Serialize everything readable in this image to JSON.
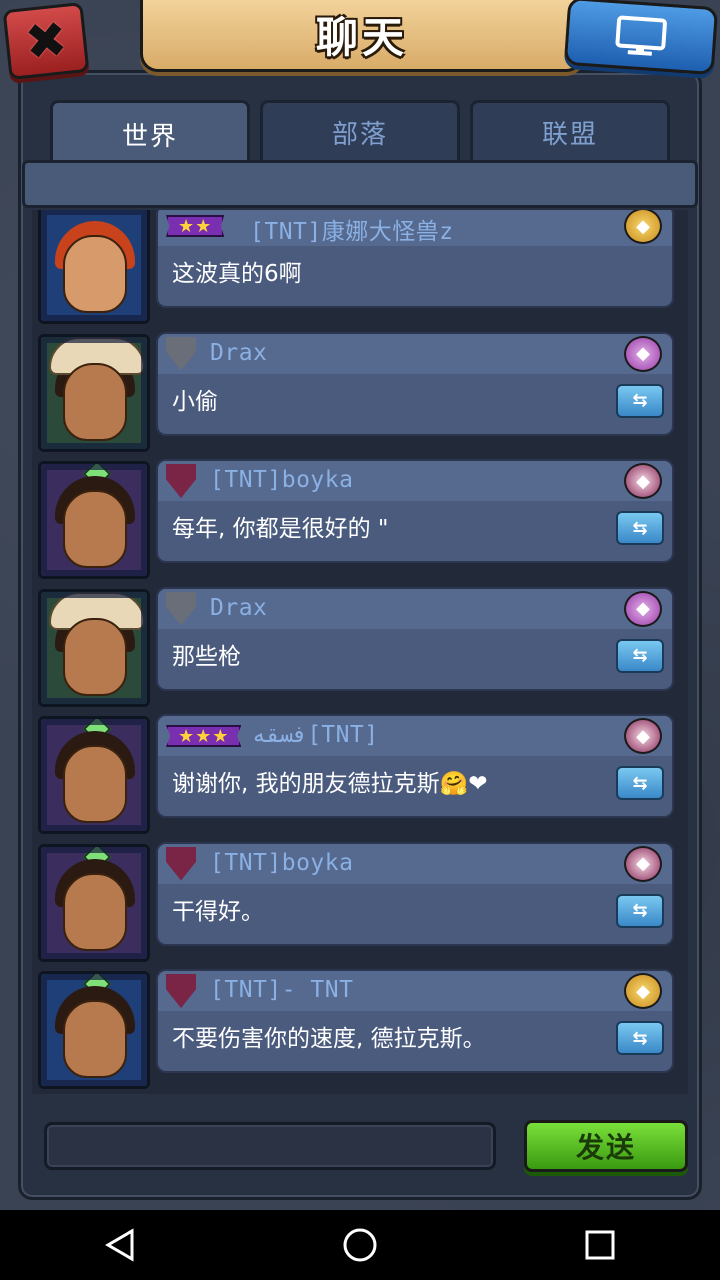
{
  "header": {
    "title": "聊天"
  },
  "tabs": [
    {
      "label": "世界"
    },
    {
      "label": "部落"
    },
    {
      "label": "联盟"
    }
  ],
  "messages": [
    {
      "rank": "★★",
      "name": "[TNT]康娜大怪兽z",
      "text": "这波真的6啊",
      "badge": "ribbon",
      "guild": "gold",
      "translate": false,
      "avatar": "blue-red"
    },
    {
      "rank": "",
      "name": "Drax",
      "text": "小偷",
      "badge": "gray",
      "guild": "purple",
      "translate": true,
      "avatar": "hood"
    },
    {
      "rank": "",
      "name": "[TNT]boyka",
      "text": "每年, 你都是很好的 \"",
      "badge": "maroon",
      "guild": "maroon",
      "translate": true,
      "avatar": "purple"
    },
    {
      "rank": "",
      "name": "Drax",
      "text": "那些枪",
      "badge": "gray",
      "guild": "purple",
      "translate": true,
      "avatar": "hood"
    },
    {
      "rank": "★★★",
      "name": "فسقه[TNT]",
      "text": "谢谢你, 我的朋友德拉克斯🤗❤",
      "badge": "ribbon",
      "guild": "maroon",
      "translate": true,
      "avatar": "purple"
    },
    {
      "rank": "",
      "name": "[TNT]boyka",
      "text": "干得好。",
      "badge": "maroon",
      "guild": "maroon",
      "translate": true,
      "avatar": "purple"
    },
    {
      "rank": "",
      "name": "[TNT]- TNT",
      "text": "不要伤害你的速度, 德拉克斯。",
      "badge": "maroon",
      "guild": "gold",
      "translate": true,
      "avatar": "blue"
    }
  ],
  "input": {
    "placeholder": ""
  },
  "send_label": "发送",
  "colors": {
    "accent": "#4a5b7a",
    "send": "#5cc224",
    "close": "#c23434",
    "monitor": "#2f7ad0"
  }
}
